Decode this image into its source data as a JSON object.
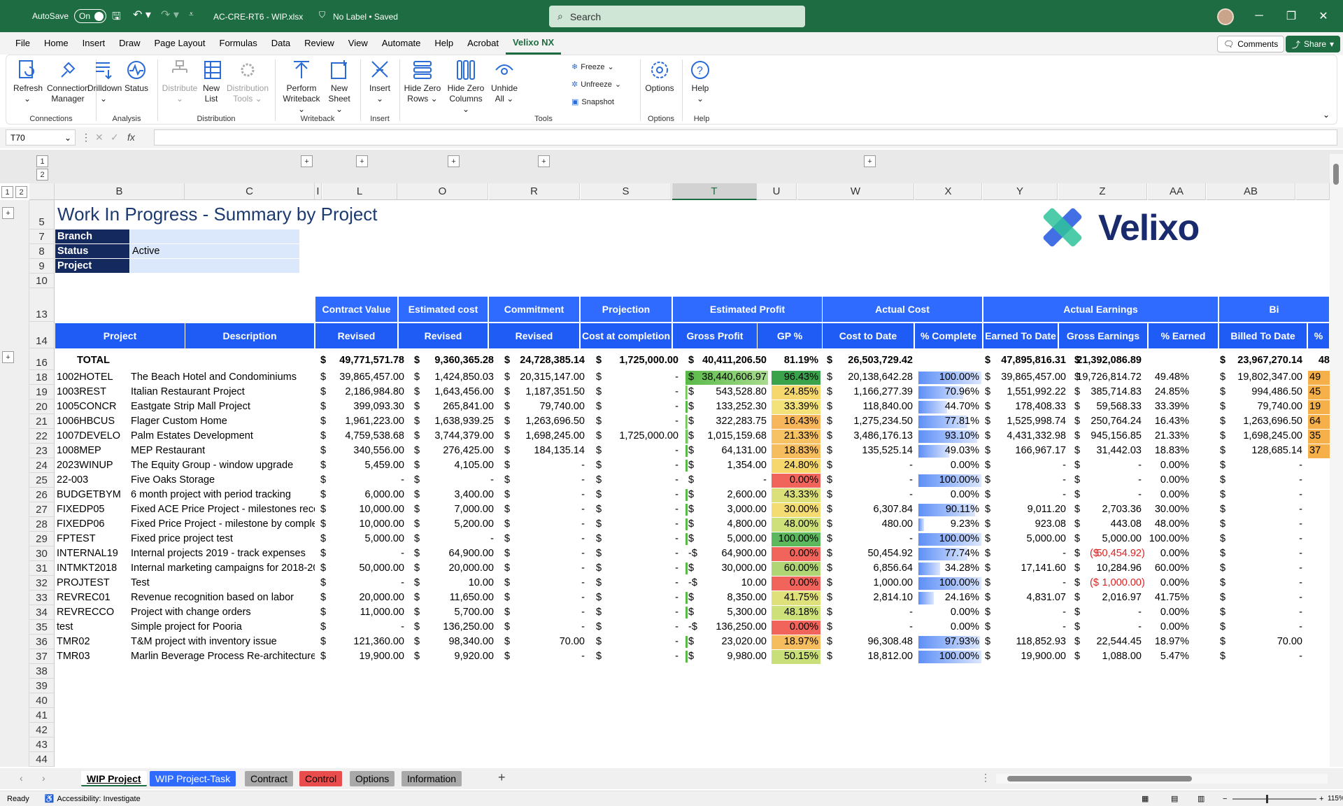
{
  "titlebar": {
    "autosave_label": "AutoSave",
    "autosave_state": "On",
    "filename": "AC-CRE-RT6 - WIP.xlsx",
    "label": "No Label • Saved",
    "search": "Search"
  },
  "menu": [
    "File",
    "Home",
    "Insert",
    "Draw",
    "Page Layout",
    "Formulas",
    "Data",
    "Review",
    "View",
    "Automate",
    "Help",
    "Acrobat",
    "Velixo NX"
  ],
  "menu_active": "Velixo NX",
  "comments_label": "Comments",
  "share_label": "Share",
  "ribbon": {
    "groups": {
      "connections": "Connections",
      "analysis": "Analysis",
      "distribution": "Distribution",
      "writeback": "Writeback",
      "insert": "Insert",
      "tools": "Tools",
      "options": "Options",
      "help": "Help"
    },
    "refresh": "Refresh",
    "conn1": "Connection",
    "conn2": "Manager",
    "drilldown": "Drilldown",
    "status": "Status",
    "distribute": "Distribute",
    "newlist1": "New",
    "newlist2": "List",
    "dt1": "Distribution",
    "dt2": "Tools",
    "pw1": "Perform",
    "pw2": "Writeback",
    "ns1": "New",
    "ns2": "Sheet",
    "insert": "Insert",
    "hzr1": "Hide Zero",
    "hzr2": "Rows",
    "hzc1": "Hide Zero",
    "hzc2": "Columns",
    "ua1": "Unhide",
    "ua2": "All",
    "freeze": "Freeze",
    "unfreeze": "Unfreeze",
    "snapshot": "Snapshot",
    "options": "Options",
    "help": "Help"
  },
  "namebox": "T70",
  "fx": "fx",
  "sheet": {
    "title": "Work In Progress - Summary by Project",
    "logo": "Velixo",
    "filters": [
      {
        "label": "Branch",
        "value": ""
      },
      {
        "label": "Status",
        "value": "Active"
      },
      {
        "label": "Project",
        "value": ""
      }
    ],
    "groups": [
      "Contract Value",
      "Estimated cost",
      "Commitment",
      "Projection",
      "Estimated Profit",
      "Actual Cost",
      "Actual Earnings",
      "Bi"
    ],
    "subheaders": [
      "Project",
      "Description",
      "Revised",
      "Revised",
      "Revised",
      "Cost at completion",
      "Gross Profit",
      "GP %",
      "Cost to Date",
      "% Complete",
      "Earned To Date",
      "Gross Earnings",
      "% Earned",
      "Billed To Date",
      "%"
    ],
    "total": {
      "label": "TOTAL",
      "contract": "49,771,571.78",
      "estcost": "9,360,365.28",
      "commit": "24,728,385.14",
      "proj": "1,725,000.00",
      "gp": "40,411,206.50",
      "gppct": "81.19%",
      "ctd": "26,503,729.42",
      "pct": "",
      "etd": "47,895,816.31",
      "ge": "21,392,086.89",
      "pe": "",
      "btd": "23,967,270.14",
      "bp": "48"
    },
    "rows": [
      {
        "r": "18",
        "p": "1002HOTEL",
        "d": "The Beach Hotel and Condominiums",
        "cv": "39,865,457.00",
        "ec": "1,424,850.03",
        "cm": "20,315,147.00",
        "pj": "-",
        "gp": "38,440,606.97",
        "gpp": "96.43%",
        "ctd": "20,138,642.28",
        "pc": "100.00%",
        "etd": "39,865,457.00",
        "ge": "19,726,814.72",
        "pe": "49.48%",
        "btd": "19,802,347.00",
        "bp": "49",
        "gpc": "#3aa24a",
        "pcf": 1.0,
        "gpbar": 1.0
      },
      {
        "r": "19",
        "p": "1003REST",
        "d": "Italian Restaurant Project",
        "cv": "2,186,984.80",
        "ec": "1,643,456.00",
        "cm": "1,187,351.50",
        "pj": "-",
        "gp": "543,528.80",
        "gpp": "24.85%",
        "ctd": "1,166,277.39",
        "pc": "70.96%",
        "etd": "1,551,992.22",
        "ge": "385,714.83",
        "pe": "24.85%",
        "btd": "994,486.50",
        "bp": "45",
        "gpc": "#f5d76e",
        "pcf": 0.71,
        "gpbar": 0.02
      },
      {
        "r": "20",
        "p": "1005CONCR",
        "d": "Eastgate Strip Mall Project",
        "cv": "399,093.30",
        "ec": "265,841.00",
        "cm": "79,740.00",
        "pj": "-",
        "gp": "133,252.30",
        "gpp": "33.39%",
        "ctd": "118,840.00",
        "pc": "44.70%",
        "etd": "178,408.33",
        "ge": "59,568.33",
        "pe": "33.39%",
        "btd": "79,740.00",
        "bp": "19",
        "gpc": "#f3e27a",
        "pcf": 0.45,
        "gpbar": 0
      },
      {
        "r": "21",
        "p": "1006HBCUS",
        "d": "Flager Custom Home",
        "cv": "1,961,223.00",
        "ec": "1,638,939.25",
        "cm": "1,263,696.50",
        "pj": "-",
        "gp": "322,283.75",
        "gpp": "16.43%",
        "ctd": "1,275,234.50",
        "pc": "77.81%",
        "etd": "1,525,998.74",
        "ge": "250,764.24",
        "pe": "16.43%",
        "btd": "1,263,696.50",
        "bp": "64",
        "gpc": "#f7b65c",
        "pcf": 0.78,
        "gpbar": 0.01
      },
      {
        "r": "22",
        "p": "1007DEVELO",
        "d": "Palm Estates Development",
        "cv": "4,759,538.68",
        "ec": "3,744,379.00",
        "cm": "1,698,245.00",
        "pj": "1,725,000.00",
        "gp": "1,015,159.68",
        "gpp": "21.33%",
        "ctd": "3,486,176.13",
        "pc": "93.10%",
        "etd": "4,431,332.98",
        "ge": "945,156.85",
        "pe": "21.33%",
        "btd": "1,698,245.00",
        "bp": "35",
        "gpc": "#f6c263",
        "pcf": 0.93,
        "gpbar": 0.03
      },
      {
        "r": "23",
        "p": "1008MEP",
        "d": "MEP Restaurant",
        "cv": "340,556.00",
        "ec": "276,425.00",
        "cm": "184,135.14",
        "pj": "-",
        "gp": "64,131.00",
        "gpp": "18.83%",
        "ctd": "135,525.14",
        "pc": "49.03%",
        "etd": "166,967.17",
        "ge": "31,442.03",
        "pe": "18.83%",
        "btd": "128,685.14",
        "bp": "37",
        "gpc": "#f6bd5f",
        "pcf": 0.49,
        "gpbar": 0
      },
      {
        "r": "24",
        "p": "2023WINUP",
        "d": "The Equity Group - window upgrade",
        "cv": "5,459.00",
        "ec": "4,105.00",
        "cm": "-",
        "pj": "-",
        "gp": "1,354.00",
        "gpp": "24.80%",
        "ctd": "-",
        "pc": "0.00%",
        "etd": "-",
        "ge": "-",
        "pe": "0.00%",
        "btd": "-",
        "bp": "",
        "gpc": "#f5d76e",
        "pcf": 0,
        "gpbar": 0
      },
      {
        "r": "25",
        "p": "22-003",
        "d": "Five Oaks Storage",
        "cv": "-",
        "ec": "-",
        "cm": "-",
        "pj": "-",
        "gp": "-",
        "gpp": "0.00%",
        "ctd": "-",
        "pc": "100.00%",
        "etd": "-",
        "ge": "-",
        "pe": "0.00%",
        "btd": "-",
        "bp": "",
        "gpc": "#f0645c",
        "pcf": 1.0,
        "gpbar": 0
      },
      {
        "r": "26",
        "p": "BUDGETBYM",
        "d": "6 month project with period tracking",
        "cv": "6,000.00",
        "ec": "3,400.00",
        "cm": "-",
        "pj": "-",
        "gp": "2,600.00",
        "gpp": "43.33%",
        "ctd": "-",
        "pc": "0.00%",
        "etd": "-",
        "ge": "-",
        "pe": "0.00%",
        "btd": "-",
        "bp": "",
        "gpc": "#dbe07a",
        "pcf": 0,
        "gpbar": 0
      },
      {
        "r": "27",
        "p": "FIXEDP05",
        "d": "Fixed ACE Price Project - milestones recognition",
        "cv": "10,000.00",
        "ec": "7,000.00",
        "cm": "-",
        "pj": "-",
        "gp": "3,000.00",
        "gpp": "30.00%",
        "ctd": "6,307.84",
        "pc": "90.11%",
        "etd": "9,011.20",
        "ge": "2,703.36",
        "pe": "30.00%",
        "btd": "-",
        "bp": "",
        "gpc": "#f4dc72",
        "pcf": 0.9,
        "gpbar": 0
      },
      {
        "r": "28",
        "p": "FIXEDP06",
        "d": "Fixed Price Project - milestone by completion",
        "cv": "10,000.00",
        "ec": "5,200.00",
        "cm": "-",
        "pj": "-",
        "gp": "4,800.00",
        "gpp": "48.00%",
        "ctd": "480.00",
        "pc": "9.23%",
        "etd": "923.08",
        "ge": "443.08",
        "pe": "48.00%",
        "btd": "-",
        "bp": "",
        "gpc": "#cde07a",
        "pcf": 0.09,
        "gpbar": 0
      },
      {
        "r": "29",
        "p": "FPTEST",
        "d": "Fixed price project test",
        "cv": "5,000.00",
        "ec": "-",
        "cm": "-",
        "pj": "-",
        "gp": "5,000.00",
        "gpp": "100.00%",
        "ctd": "-",
        "pc": "100.00%",
        "etd": "5,000.00",
        "ge": "5,000.00",
        "pe": "100.00%",
        "btd": "-",
        "bp": "",
        "gpc": "#5bb85c",
        "pcf": 1.0,
        "gpbar": 0
      },
      {
        "r": "30",
        "p": "INTERNAL19",
        "d": "Internal projects 2019 - track expenses",
        "cv": "-",
        "ec": "64,900.00",
        "cm": "-",
        "pj": "-",
        "gp": "64,900.00",
        "gpp": "0.00%",
        "ctd": "50,454.92",
        "pc": "77.74%",
        "etd": "-",
        "ge": "50,454.92",
        "pe": "0.00%",
        "btd": "-",
        "bp": "",
        "gpc": "#f0645c",
        "pcf": 0.78,
        "gpbar": 0,
        "neg": true,
        "geneg": true
      },
      {
        "r": "31",
        "p": "INTMKT2018",
        "d": "Internal marketing campaigns for 2018-2019",
        "cv": "50,000.00",
        "ec": "20,000.00",
        "cm": "-",
        "pj": "-",
        "gp": "30,000.00",
        "gpp": "60.00%",
        "ctd": "6,856.64",
        "pc": "34.28%",
        "etd": "17,141.60",
        "ge": "10,284.96",
        "pe": "60.00%",
        "btd": "-",
        "bp": "",
        "gpc": "#afd574",
        "pcf": 0.34,
        "gpbar": 0
      },
      {
        "r": "32",
        "p": "PROJTEST",
        "d": "Test",
        "cv": "-",
        "ec": "10.00",
        "cm": "-",
        "pj": "-",
        "gp": "10.00",
        "gpp": "0.00%",
        "ctd": "1,000.00",
        "pc": "100.00%",
        "etd": "-",
        "ge": "1,000.00",
        "pe": "0.00%",
        "btd": "-",
        "bp": "",
        "gpc": "#f0645c",
        "pcf": 1.0,
        "gpbar": 0,
        "neg": true,
        "geneg": true
      },
      {
        "r": "33",
        "p": "REVREC01",
        "d": "Revenue recognition based on labor",
        "cv": "20,000.00",
        "ec": "11,650.00",
        "cm": "-",
        "pj": "-",
        "gp": "8,350.00",
        "gpp": "41.75%",
        "ctd": "2,814.10",
        "pc": "24.16%",
        "etd": "4,831.07",
        "ge": "2,016.97",
        "pe": "41.75%",
        "btd": "-",
        "bp": "",
        "gpc": "#dfe07a",
        "pcf": 0.24,
        "gpbar": 0
      },
      {
        "r": "34",
        "p": "REVRECCO",
        "d": "Project with change orders",
        "cv": "11,000.00",
        "ec": "5,700.00",
        "cm": "-",
        "pj": "-",
        "gp": "5,300.00",
        "gpp": "48.18%",
        "ctd": "-",
        "pc": "0.00%",
        "etd": "-",
        "ge": "-",
        "pe": "0.00%",
        "btd": "-",
        "bp": "",
        "gpc": "#cde07a",
        "pcf": 0,
        "gpbar": 0
      },
      {
        "r": "35",
        "p": "test",
        "d": "Simple project for Pooria",
        "cv": "-",
        "ec": "136,250.00",
        "cm": "-",
        "pj": "-",
        "gp": "136,250.00",
        "gpp": "0.00%",
        "ctd": "-",
        "pc": "0.00%",
        "etd": "-",
        "ge": "-",
        "pe": "0.00%",
        "btd": "-",
        "bp": "",
        "gpc": "#f0645c",
        "pcf": 0,
        "gpbar": 0,
        "neg": true
      },
      {
        "r": "36",
        "p": "TMR02",
        "d": "T&M project with inventory issue",
        "cv": "121,360.00",
        "ec": "98,340.00",
        "cm": "70.00",
        "pj": "-",
        "gp": "23,020.00",
        "gpp": "18.97%",
        "ctd": "96,308.48",
        "pc": "97.93%",
        "etd": "118,852.93",
        "ge": "22,544.45",
        "pe": "18.97%",
        "btd": "70.00",
        "bp": "",
        "gpc": "#f6bd5f",
        "pcf": 0.98,
        "gpbar": 0
      },
      {
        "r": "37",
        "p": "TMR03",
        "d": "Marlin Beverage Process Re-architecture",
        "cv": "19,900.00",
        "ec": "9,920.00",
        "cm": "-",
        "pj": "-",
        "gp": "9,980.00",
        "gpp": "50.15%",
        "ctd": "18,812.00",
        "pc": "100.00%",
        "etd": "19,900.00",
        "ge": "1,088.00",
        "pe": "5.47%",
        "btd": "-",
        "bp": "",
        "gpc": "#c9df79",
        "pcf": 1.0,
        "gpbar": 0
      }
    ]
  },
  "col_headers": [
    "B",
    "C",
    "I",
    "L",
    "O",
    "R",
    "S",
    "T",
    "U",
    "W",
    "X",
    "Y",
    "Z",
    "AA",
    "AB"
  ],
  "row_numbers": [
    "5",
    "7",
    "8",
    "9",
    "10",
    "13",
    "14",
    "16",
    "18",
    "19",
    "20",
    "21",
    "22",
    "23",
    "24",
    "25",
    "26",
    "27",
    "28",
    "29",
    "30",
    "31",
    "32",
    "33",
    "34",
    "35",
    "36",
    "37",
    "38",
    "39",
    "40",
    "41",
    "42",
    "43",
    "44"
  ],
  "tabs": [
    "WIP Project",
    "WIP Project-Task",
    "Contract",
    "Control",
    "Options",
    "Information"
  ],
  "status": {
    "ready": "Ready",
    "accessibility": "Accessibility: Investigate",
    "zoom": "115%"
  }
}
